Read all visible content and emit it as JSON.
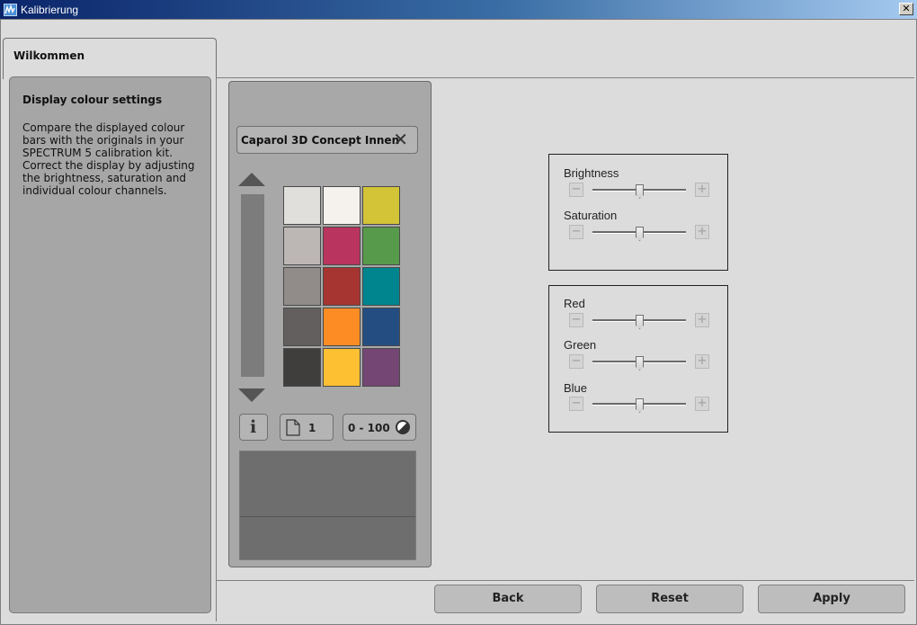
{
  "window": {
    "title": "Kalibrierung",
    "close_label": "✕"
  },
  "tab": {
    "label": "Wilkommen"
  },
  "info": {
    "title": "Display colour settings",
    "body": "Compare the displayed colour bars with the originals in your SPECTRUM 5 calibration kit. Correct the display by adjusting the brightness, saturation and individual colour channels."
  },
  "colour_chart": {
    "name": "Caparol 3D Concept Innen",
    "clear_label": "✕",
    "page_number": "1",
    "range_label": "0 - 100",
    "swatches": [
      "#e0dfdc",
      "#f5f1ec",
      "#d2c337",
      "#bcb6b5",
      "#b9345e",
      "#589a4b",
      "#918b89",
      "#a63531",
      "#00858f",
      "#635f5e",
      "#fd8c25",
      "#244e82",
      "#403e3d",
      "#fec033",
      "#744673"
    ]
  },
  "sliders": {
    "brightness": {
      "label": "Brightness",
      "value": 0.5,
      "minus": "−",
      "plus": "+"
    },
    "saturation": {
      "label": "Saturation",
      "value": 0.5,
      "minus": "−",
      "plus": "+"
    },
    "red": {
      "label": "Red",
      "value": 0.5,
      "minus": "−",
      "plus": "+"
    },
    "green": {
      "label": "Green",
      "value": 0.5,
      "minus": "−",
      "plus": "+"
    },
    "blue": {
      "label": "Blue",
      "value": 0.5,
      "minus": "−",
      "plus": "+"
    }
  },
  "footer": {
    "back_label": "Back",
    "reset_label": "Reset",
    "apply_label": "Apply"
  }
}
